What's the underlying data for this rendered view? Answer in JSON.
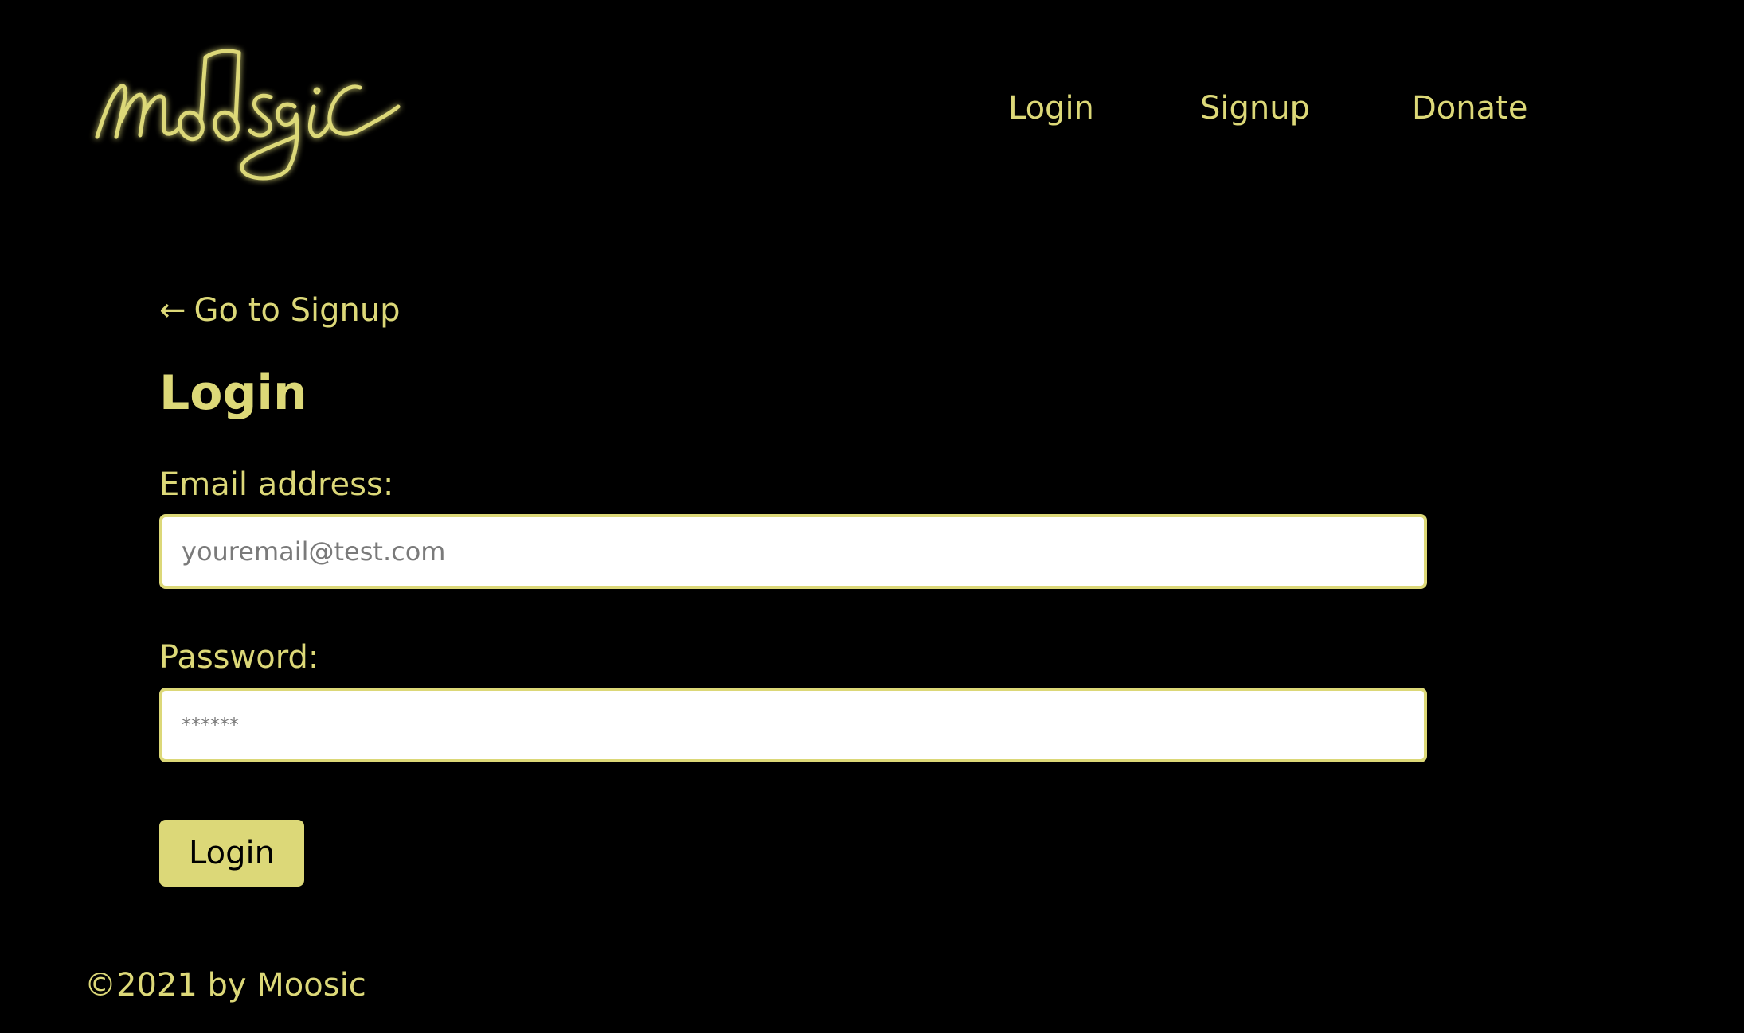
{
  "header": {
    "logo_text": "moosic",
    "nav": {
      "login": "Login",
      "signup": "Signup",
      "donate": "Donate"
    }
  },
  "main": {
    "back_link": {
      "icon": "arrow-left-icon",
      "arrow": "←",
      "label": "Go to Signup"
    },
    "title": "Login",
    "email": {
      "label": "Email address:",
      "placeholder": "youremail@test.com",
      "value": ""
    },
    "password": {
      "label": "Password:",
      "placeholder": "******",
      "value": ""
    },
    "submit_label": "Login"
  },
  "footer": {
    "text": "©2021 by Moosic"
  },
  "colors": {
    "background": "#000000",
    "accent": "#dcd878",
    "input_background": "#ffffff",
    "button_text": "#000000"
  }
}
